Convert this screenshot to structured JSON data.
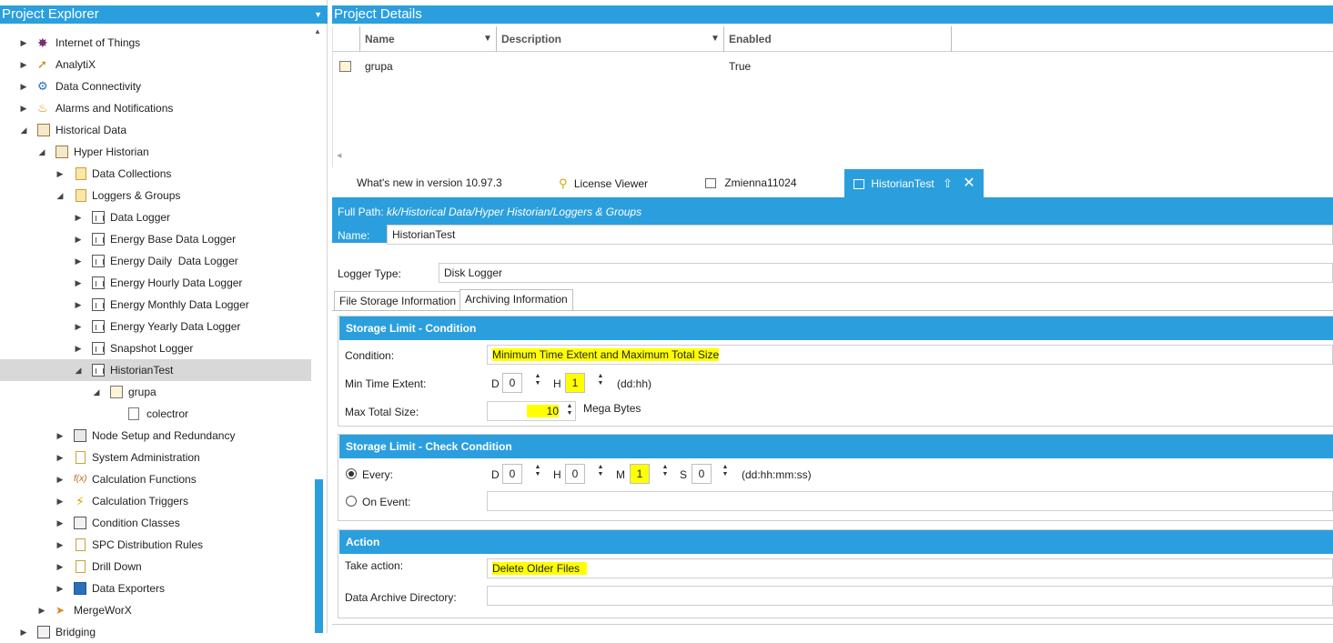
{
  "explorer": {
    "title": "Project Explorer",
    "items": [
      {
        "label": "Internet of Things",
        "icon": "iot-icon"
      },
      {
        "label": "AnalytiX",
        "icon": "analytix-icon"
      },
      {
        "label": "Data Connectivity",
        "icon": "gears-icon"
      },
      {
        "label": "Alarms and Notifications",
        "icon": "alarm-bell-icon"
      },
      {
        "label": "Historical Data",
        "icon": "historical-data-icon"
      },
      {
        "label": "Hyper Historian",
        "icon": "hyper-historian-icon"
      },
      {
        "label": "Data Collections",
        "icon": "folder-icon"
      },
      {
        "label": "Loggers & Groups",
        "icon": "folder-icon"
      },
      {
        "label": "Data Logger",
        "icon": "logger-icon"
      },
      {
        "label": "Energy Base Data Logger",
        "icon": "logger-icon"
      },
      {
        "label": "Energy Daily  Data Logger",
        "icon": "logger-icon"
      },
      {
        "label": "Energy Hourly Data Logger",
        "icon": "logger-icon"
      },
      {
        "label": "Energy Monthly Data Logger",
        "icon": "logger-icon"
      },
      {
        "label": "Energy Yearly Data Logger",
        "icon": "logger-icon"
      },
      {
        "label": "Snapshot Logger",
        "icon": "logger-icon"
      },
      {
        "label": "HistorianTest",
        "icon": "logger-icon"
      },
      {
        "label": "grupa",
        "icon": "group-icon"
      },
      {
        "label": "colectror",
        "icon": "collector-icon"
      },
      {
        "label": "Node Setup and Redundancy",
        "icon": "node-setup-icon"
      },
      {
        "label": "System Administration",
        "icon": "document-icon"
      },
      {
        "label": "Calculation Functions",
        "icon": "function-icon"
      },
      {
        "label": "Calculation Triggers",
        "icon": "lightning-icon"
      },
      {
        "label": "Condition Classes",
        "icon": "condition-icon"
      },
      {
        "label": "SPC Distribution Rules",
        "icon": "spc-icon"
      },
      {
        "label": "Drill Down",
        "icon": "drill-down-icon"
      },
      {
        "label": "Data Exporters",
        "icon": "exporter-icon"
      },
      {
        "label": "MergeWorX",
        "icon": "mergeworx-icon"
      },
      {
        "label": "Bridging",
        "icon": "bridging-icon"
      }
    ]
  },
  "details": {
    "title": "Project Details",
    "columns": [
      "Name",
      "Description",
      "Enabled"
    ],
    "rows": [
      {
        "name": "grupa",
        "description": "",
        "enabled": "True"
      }
    ]
  },
  "tabs": [
    {
      "label": "What's new in version 10.97.3",
      "icon": ""
    },
    {
      "label": "License Viewer",
      "icon": "key-icon"
    },
    {
      "label": "Zmienna11024",
      "icon": "grid-icon"
    },
    {
      "label": "HistorianTest",
      "icon": "logger-icon",
      "active": true
    }
  ],
  "editor": {
    "full_path_label": "Full Path:",
    "full_path_value": "kk/Historical Data/Hyper Historian/Loggers & Groups",
    "name_label": "Name:",
    "name_value": "HistorianTest",
    "logger_type_label": "Logger Type:",
    "logger_type_value": "Disk Logger",
    "subtabs": [
      "File Storage Information",
      "Archiving Information"
    ],
    "storage_condition": {
      "title": "Storage Limit - Condition",
      "condition_label": "Condition:",
      "condition_value": "Minimum Time Extent and Maximum Total Size",
      "min_time_label": "Min Time Extent:",
      "d_label": "D",
      "d_value": "0",
      "h_label": "H",
      "h_value": "1",
      "min_time_unit": "(dd:hh)",
      "max_size_label": "Max Total Size:",
      "max_size_value": "10",
      "max_size_unit": "Mega Bytes"
    },
    "check_condition": {
      "title": "Storage Limit - Check Condition",
      "every_label": "Every:",
      "d_label": "D",
      "d_value": "0",
      "h_label": "H",
      "h_value": "0",
      "m_label": "M",
      "m_value": "1",
      "s_label": "S",
      "s_value": "0",
      "unit": "(dd:hh:mm:ss)",
      "on_event_label": "On Event:",
      "on_event_value": ""
    },
    "action": {
      "title": "Action",
      "take_action_label": "Take action:",
      "take_action_value": "Delete Older Files",
      "archive_dir_label": "Data Archive Directory:",
      "archive_dir_value": ""
    }
  },
  "colors": {
    "accent": "#2b9fde",
    "highlight": "#ffff00",
    "selection": "#d8d8d8"
  }
}
